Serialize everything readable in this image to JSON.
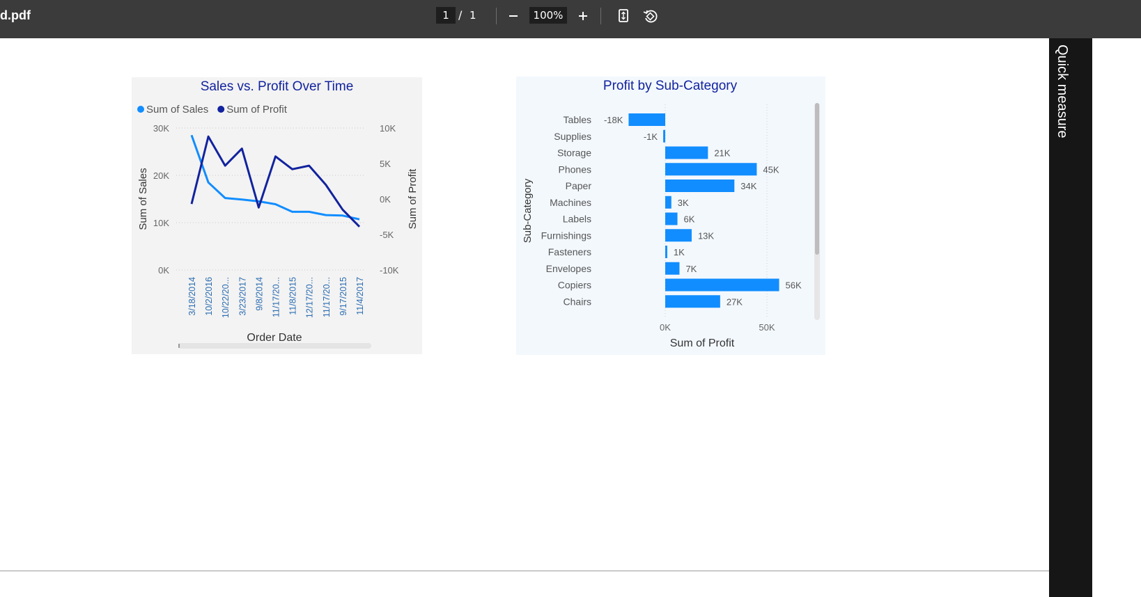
{
  "toolbar": {
    "filename": "d.pdf",
    "current_page": "1",
    "separator": "/",
    "total_pages": "1",
    "zoom": "100%",
    "zoom_out_icon": "minus-icon",
    "zoom_in_icon": "plus-icon",
    "fit_icon": "fit-page-icon",
    "rotate_icon": "rotate-icon"
  },
  "side_pane": {
    "label": "Quick measure"
  },
  "colors": {
    "sales": "#118dff",
    "profit": "#12239e",
    "bar": "#118dff",
    "title": "#12239e"
  },
  "chart_data": [
    {
      "type": "line",
      "title": "Sales vs. Profit Over Time",
      "xlabel": "Order Date",
      "ylabel": "Sum of Sales",
      "y2label": "Sum of Profit",
      "categories": [
        "3/18/2014",
        "10/2/2016",
        "10/22/20...",
        "3/23/2017",
        "9/8/2014",
        "11/17/20...",
        "11/8/2015",
        "12/17/20...",
        "11/17/20...",
        "9/17/2015",
        "11/4/2017"
      ],
      "series": [
        {
          "name": "Sum of Sales",
          "axis": "left",
          "values": [
            28500,
            18500,
            15200,
            14900,
            14500,
            13900,
            12300,
            12300,
            11600,
            11500,
            10700
          ]
        },
        {
          "name": "Sum of Profit",
          "axis": "right",
          "values": [
            -700,
            8800,
            4700,
            7100,
            -1200,
            6000,
            4200,
            4700,
            2000,
            -1500,
            -3900
          ]
        }
      ],
      "yticks": [
        "30K",
        "20K",
        "10K",
        "0K"
      ],
      "y2ticks": [
        "10K",
        "5K",
        "0K",
        "-5K",
        "-10K"
      ],
      "ylim": [
        0,
        30000
      ],
      "y2lim": [
        -10000,
        10000
      ],
      "legend": "top-left"
    },
    {
      "type": "bar",
      "orientation": "horizontal",
      "title": "Profit by Sub-Category",
      "xlabel": "Sum of Profit",
      "ylabel": "Sub-Category",
      "categories": [
        "Tables",
        "Supplies",
        "Storage",
        "Phones",
        "Paper",
        "Machines",
        "Labels",
        "Furnishings",
        "Fasteners",
        "Envelopes",
        "Copiers",
        "Chairs"
      ],
      "values": [
        -18000,
        -1000,
        21000,
        45000,
        34000,
        3000,
        6000,
        13000,
        1000,
        7000,
        56000,
        27000
      ],
      "labels": [
        "-18K",
        "-1K",
        "21K",
        "45K",
        "34K",
        "3K",
        "6K",
        "13K",
        "1K",
        "7K",
        "56K",
        "27K"
      ],
      "xticks": [
        "0K",
        "50K"
      ],
      "xtick_values": [
        0,
        50000
      ]
    }
  ]
}
